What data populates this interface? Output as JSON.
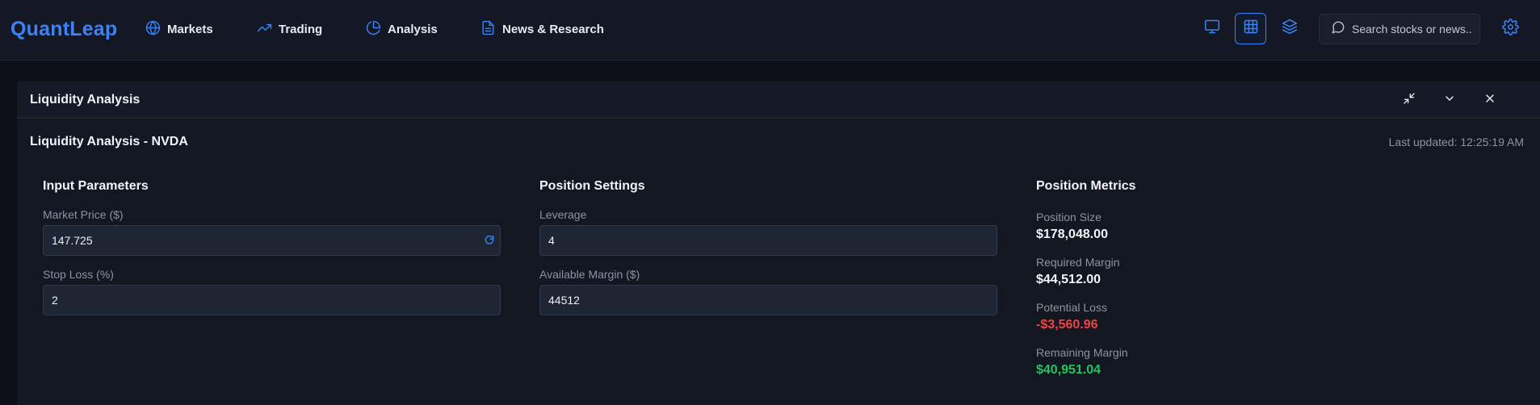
{
  "app": {
    "logo": "QuantLeap"
  },
  "nav": {
    "items": [
      {
        "label": "Markets",
        "icon": "globe-icon"
      },
      {
        "label": "Trading",
        "icon": "trending-up-icon"
      },
      {
        "label": "Analysis",
        "icon": "pie-chart-icon"
      },
      {
        "label": "News & Research",
        "icon": "file-text-icon"
      }
    ]
  },
  "toolbar": {
    "buttons": [
      {
        "icon": "monitor-icon",
        "active": false
      },
      {
        "icon": "grid-icon",
        "active": true
      },
      {
        "icon": "layers-icon",
        "active": false
      }
    ],
    "search_placeholder": "Search stocks or news...",
    "settings_icon": "gear-icon"
  },
  "panel": {
    "title": "Liquidity Analysis",
    "subtitle": "Liquidity Analysis - NVDA",
    "last_updated_label": "Last updated: ",
    "last_updated_time": "12:25:19 AM",
    "header_icons": [
      "minimize-icon",
      "chevron-down-icon",
      "close-icon"
    ]
  },
  "inputs": {
    "title": "Input Parameters",
    "market_price_label": "Market Price ($)",
    "market_price_value": "147.725",
    "stop_loss_label": "Stop Loss (%)",
    "stop_loss_value": "2"
  },
  "position": {
    "title": "Position Settings",
    "leverage_label": "Leverage",
    "leverage_value": "4",
    "margin_label": "Available Margin ($)",
    "margin_value": "44512"
  },
  "metrics": {
    "title": "Position Metrics",
    "position_size_label": "Position Size",
    "position_size_value": "$178,048.00",
    "required_margin_label": "Required Margin",
    "required_margin_value": "$44,512.00",
    "potential_loss_label": "Potential Loss",
    "potential_loss_value": "-$3,560.96",
    "remaining_margin_label": "Remaining Margin",
    "remaining_margin_value": "$40,951.04"
  },
  "colors": {
    "accent": "#3b82f6",
    "negative": "#ef4444",
    "positive": "#22c55e",
    "background": "#0c0f17",
    "panel": "#131722"
  }
}
